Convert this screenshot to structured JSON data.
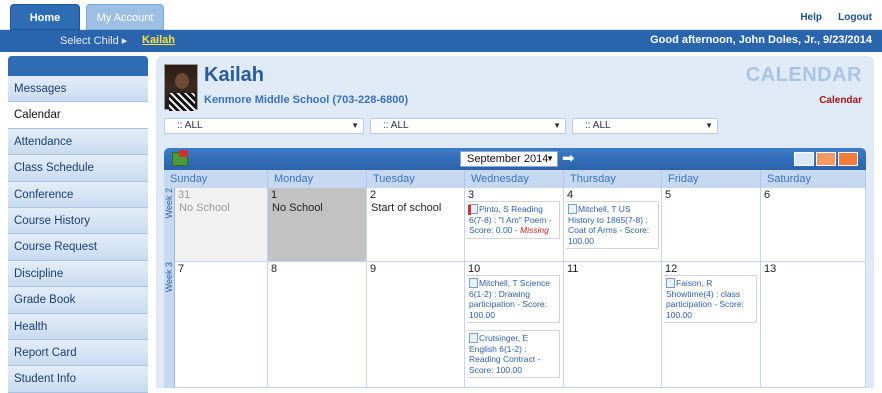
{
  "top_tabs": [
    "Home",
    "My Account"
  ],
  "top_links": {
    "help": "Help",
    "logout": "Logout"
  },
  "child_bar": {
    "select_child": "Select Child ▸",
    "child_name": "Kailah",
    "greeting": "Good afternoon, John Doles, Jr., 9/23/2014"
  },
  "sidebar": {
    "items": [
      "Messages",
      "Calendar",
      "Attendance",
      "Class Schedule",
      "Conference",
      "Course History",
      "Course Request",
      "Discipline",
      "Grade Book",
      "Health",
      "Report Card",
      "Student Info"
    ],
    "active": "Calendar"
  },
  "student": {
    "name": "Kailah",
    "school": "Kenmore Middle School (703-228-6800)"
  },
  "page": {
    "title": "CALENDAR",
    "subtitle": "Calendar"
  },
  "filters": [
    ":: ALL",
    ":: ALL",
    ":: ALL"
  ],
  "calendar": {
    "month_select": "September 2014",
    "days": [
      "Sunday",
      "Monday",
      "Tuesday",
      "Wednesday",
      "Thursday",
      "Friday",
      "Saturday"
    ],
    "weeks": [
      {
        "label": "Week 2",
        "cells": [
          {
            "num": "31",
            "label": "No School",
            "events": []
          },
          {
            "num": "1",
            "label": "No School",
            "events": []
          },
          {
            "num": "2",
            "label": "Start of school",
            "events": []
          },
          {
            "num": "3",
            "label": "",
            "events": [
              {
                "text": "Pinto, S Reading 6(7-8) : \"I Am\" Poem - Score: 0.00 - ",
                "missing": "Missing"
              }
            ]
          },
          {
            "num": "4",
            "label": "",
            "events": [
              {
                "text": "Mitchell, T US History to 1865(7-8) : Coat of Arms - Score: 100.00",
                "missing": ""
              }
            ]
          },
          {
            "num": "5",
            "label": "",
            "events": []
          },
          {
            "num": "6",
            "label": "",
            "events": []
          }
        ]
      },
      {
        "label": "Week 3",
        "cells": [
          {
            "num": "7",
            "label": "",
            "events": []
          },
          {
            "num": "8",
            "label": "",
            "events": []
          },
          {
            "num": "9",
            "label": "",
            "events": []
          },
          {
            "num": "10",
            "label": "",
            "events": [
              {
                "text": "Mitchell, T Science 6(1-2) : Drawing participation - Score: 100.00",
                "missing": ""
              },
              {
                "text": "Crutsinger, E English 6(1-2) : Reading Contract - Score: 100.00",
                "missing": ""
              }
            ]
          },
          {
            "num": "11",
            "label": "",
            "events": []
          },
          {
            "num": "12",
            "label": "",
            "events": [
              {
                "text": "Faison, R Showtime(4) : class participation - Score: 100.00",
                "missing": ""
              }
            ]
          },
          {
            "num": "13",
            "label": "",
            "events": []
          }
        ]
      }
    ]
  },
  "icons": [
    "print-calendar-icon",
    "next-month-icon",
    "day-view-icon",
    "week-view-icon",
    "month-view-icon",
    "assignment-doc-icon"
  ]
}
